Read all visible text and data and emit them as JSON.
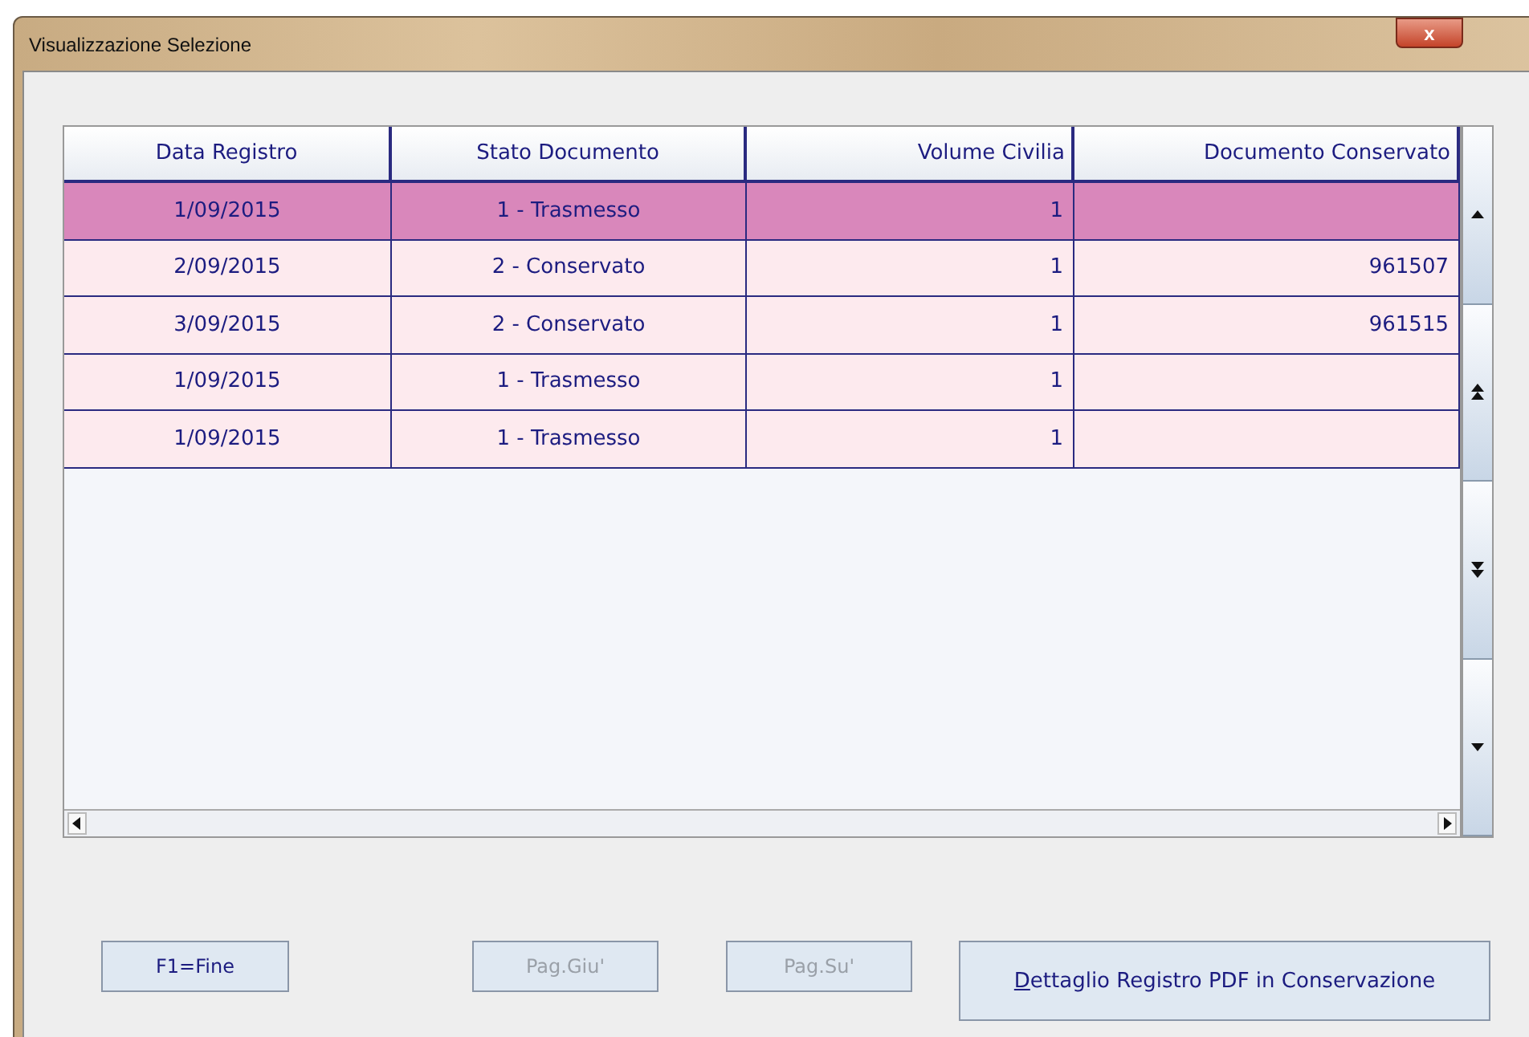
{
  "window": {
    "title": "Visualizzazione Selezione",
    "close": "x"
  },
  "table": {
    "columns": [
      {
        "label": "Data Registro",
        "kind": "text"
      },
      {
        "label": "Stato Documento",
        "kind": "text"
      },
      {
        "label": "Volume Civilia",
        "kind": "numeric"
      },
      {
        "label": "Documento Conservato",
        "kind": "numeric"
      }
    ],
    "rows": [
      {
        "selected": true,
        "cells": [
          "1/09/2015",
          "1 - Trasmesso",
          "1",
          ""
        ]
      },
      {
        "selected": false,
        "cells": [
          "2/09/2015",
          "2 - Conservato",
          "1",
          "961507"
        ]
      },
      {
        "selected": false,
        "cells": [
          "3/09/2015",
          "2 - Conservato",
          "1",
          "961515"
        ]
      },
      {
        "selected": false,
        "cells": [
          "1/09/2015",
          "1 - Trasmesso",
          "1",
          ""
        ]
      },
      {
        "selected": false,
        "cells": [
          "1/09/2015",
          "1 - Trasmesso",
          "1",
          ""
        ]
      }
    ]
  },
  "buttons": [
    {
      "label": "F1=Fine",
      "disabled": false,
      "mnemonic_first": false
    },
    {
      "label": "Pag.Giu'",
      "disabled": true,
      "mnemonic_first": false
    },
    {
      "label": "Pag.Su'",
      "disabled": true,
      "mnemonic_first": false
    },
    {
      "label": "Dettaglio Registro PDF in Conservazione",
      "disabled": false,
      "mnemonic_first": true
    }
  ]
}
